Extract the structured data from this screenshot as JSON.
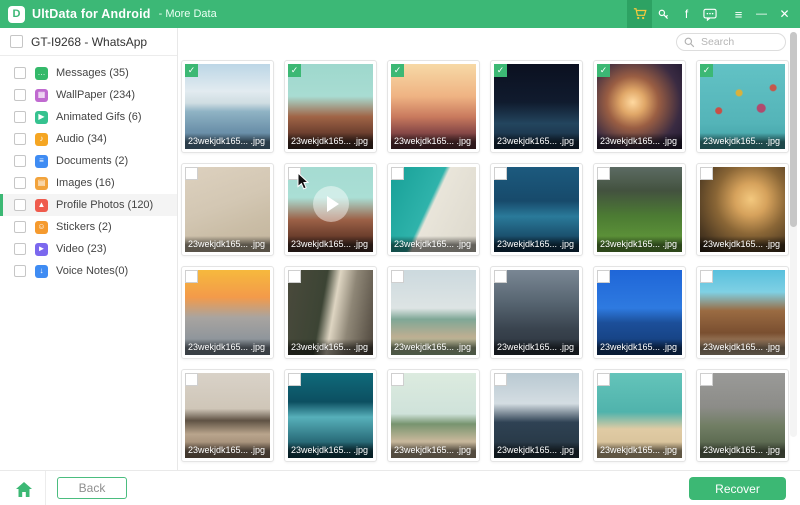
{
  "titlebar": {
    "app_title": "UltData for Android",
    "subtitle": "- More Data",
    "logo_glyph": "D",
    "facebook_glyph": "f",
    "menu_glyph": "≡",
    "minimize_glyph": "—",
    "close_glyph": "✕",
    "bg_color": "#3cb876",
    "cart_bg_color": "#2da263",
    "cart_color": "#f6c93e"
  },
  "search": {
    "placeholder": "Search"
  },
  "sidebar": {
    "device_label": "GT-I9268 - WhatsApp",
    "accent": "#3cb874",
    "items": [
      {
        "label": "Messages (35)",
        "color": "#34b96a",
        "glyph": "…",
        "selected": false
      },
      {
        "label": "WallPaper (234)",
        "color": "#c06ad0",
        "glyph": "▦",
        "selected": false
      },
      {
        "label": "Animated Gifs (6)",
        "color": "#35c28f",
        "glyph": "▶",
        "selected": false
      },
      {
        "label": "Audio (34)",
        "color": "#f5a623",
        "glyph": "♪",
        "selected": false
      },
      {
        "label": "Documents (2)",
        "color": "#3f8cf3",
        "glyph": "≡",
        "selected": false
      },
      {
        "label": "Images (16)",
        "color": "#f2a33c",
        "glyph": "▤",
        "selected": false
      },
      {
        "label": "Profile Photos (120)",
        "color": "#ef5b4d",
        "glyph": "▲",
        "selected": true
      },
      {
        "label": "Stickers (2)",
        "color": "#f59a2e",
        "glyph": "☺",
        "selected": false
      },
      {
        "label": "Video (23)",
        "color": "#7b68ee",
        "glyph": "►",
        "selected": false
      },
      {
        "label": "Voice Notes(0)",
        "color": "#3f8cf3",
        "glyph": "↓",
        "selected": false
      }
    ]
  },
  "grid": {
    "filename": "23wekjdk165... .jpg",
    "check_glyph": "✓",
    "photos": [
      {
        "bg": "linear-gradient(180deg,#bcd6e6 0%,#e2ebf0 32%,#cfdde2 46%,#8fb3c4 56%,#6d92ab 78%,#5c84a0 100%)",
        "checked": true,
        "play": false,
        "cursor": false
      },
      {
        "bg": "linear-gradient(180deg,#9ed8cd 0%,#a8dcd2 38%,#a06446 62%,#6b3e2e 82%,#3f2b24 100%)",
        "checked": true,
        "play": false,
        "cursor": false
      },
      {
        "bg": "linear-gradient(180deg,#f7d9a6 0%,#efb383 38%,#c97a5e 62%,#8a4a48 80%,#5c3038 100%)",
        "checked": true,
        "play": false,
        "cursor": false
      },
      {
        "bg": "linear-gradient(180deg,#0b1020 0%,#101b2e 45%,#23455e 70%,#15293e 100%)",
        "checked": true,
        "play": false,
        "cursor": false
      },
      {
        "bg": "radial-gradient(circle at 42% 45%,#ffd9a0 0%,#e0a768 18%,#9a5e43 38%,#3a2b42 70%,#1f1830 100%)",
        "checked": true,
        "play": false,
        "cursor": false
      },
      {
        "bg": "radial-gradient(circle at 22% 55%,#c94f46 0,#c94f46 3px,rgba(0,0,0,0) 4px),radial-gradient(circle at 46% 34%,#d8b13c 0,#d8b13c 3px,rgba(0,0,0,0) 4px),radial-gradient(circle at 72% 52%,#b04a6e 0,#b04a6e 4px,rgba(0,0,0,0) 5px),radial-gradient(circle at 86% 28%,#c5584c 0,#c5584c 3px,rgba(0,0,0,0) 4px),linear-gradient(180deg,#62c2c5 0%,#54b4b8 70%,#3e9da2 100%)",
        "checked": true,
        "play": false,
        "cursor": false
      },
      {
        "bg": "linear-gradient(160deg,#ddd1bf 0%,#d3c7b3 45%,#cabda6 70%,#c2b49c 100%)",
        "checked": false,
        "play": false,
        "cursor": false
      },
      {
        "bg": "linear-gradient(180deg,#a5dbd2 0%,#aadfd5 36%,#9c6147 62%,#6a3d2c 82%,#45302a 100%)",
        "checked": false,
        "play": true,
        "cursor": true
      },
      {
        "bg": "linear-gradient(115deg,#17a097 0%,#2fb3ab 44%,#e9e5da 48%,#dcd8cc 100%)",
        "checked": false,
        "play": false,
        "cursor": false
      },
      {
        "bg": "linear-gradient(180deg,#1c5a7e 0%,#174a6b 40%,#2a7a9a 58%,#0e2f4a 100%)",
        "checked": false,
        "play": false,
        "cursor": false
      },
      {
        "bg": "linear-gradient(180deg,#5c6b63 0%,#43523f 28%,#4c7c33 58%,#67a03c 100%)",
        "checked": false,
        "play": false,
        "cursor": false
      },
      {
        "bg": "radial-gradient(circle at 60% 38%,#f3c87e 0%,#d6a25c 22%,#8a6636 48%,#4e3a22 78%,#2c2114 100%)",
        "checked": false,
        "play": false,
        "cursor": false
      },
      {
        "bg": "linear-gradient(180deg,#f6b93d 0%,#f39a4a 32%,#a8a4a0 56%,#7d8b98 100%)",
        "checked": false,
        "play": false,
        "cursor": false
      },
      {
        "bg": "linear-gradient(100deg,#4a4a3c 0%,#3c4434 40%,#ded5c2 53%,#8e8676 70%,#4e463c 100%)",
        "checked": false,
        "play": false,
        "cursor": false
      },
      {
        "bg": "linear-gradient(180deg,#ccd9de 0%,#dde4e4 45%,#7fa796 58%,#bcae92 78%,#a8c49a 100%)",
        "checked": false,
        "play": false,
        "cursor": false
      },
      {
        "bg": "linear-gradient(180deg,#7a8794 0%,#55636f 40%,#39434e 70%,#2b333c 100%)",
        "checked": false,
        "play": false,
        "cursor": false
      },
      {
        "bg": "linear-gradient(180deg,#1f66d8 0%,#2e7ae0 45%,#1c4f9a 62%,#123a74 100%)",
        "checked": false,
        "play": false,
        "cursor": false
      },
      {
        "bg": "linear-gradient(180deg,#59c0dd 0%,#7fd0e4 26%,#9a6b42 48%,#7a4f30 74%,#c4b49a 100%)",
        "checked": false,
        "play": false,
        "cursor": false
      },
      {
        "bg": "linear-gradient(180deg,#d9d2c8 0%,#cfc6b8 42%,#5f5244 56%,#b9a48c 72%,#8a7460 100%)",
        "checked": false,
        "play": false,
        "cursor": false
      },
      {
        "bg": "linear-gradient(180deg,#0f6a7a 0%,#0c4f61 34%,#57b0ba 52%,#0a3d4c 100%)",
        "checked": false,
        "play": false,
        "cursor": false
      },
      {
        "bg": "linear-gradient(180deg,#dcebdf 0%,#cfe2da 48%,#77946f 60%,#c7b79b 80%,#b5a489 100%)",
        "checked": false,
        "play": false,
        "cursor": false
      },
      {
        "bg": "linear-gradient(180deg,#b9c9d2 0%,#d4dde2 36%,#2f4254 58%,#24343f 100%)",
        "checked": false,
        "play": false,
        "cursor": false
      },
      {
        "bg": "linear-gradient(180deg,#64c4ba 0%,#50b3ac 46%,#e0cba4 66%,#d3bd94 100%)",
        "checked": false,
        "play": false,
        "cursor": false
      },
      {
        "bg": "linear-gradient(180deg,#9a9a98 0%,#8c8c88 40%,#717e64 62%,#5d6b52 82%,#768266 100%)",
        "checked": false,
        "play": false,
        "cursor": false
      }
    ]
  },
  "footer": {
    "back_label": "Back",
    "recover_label": "Recover"
  }
}
